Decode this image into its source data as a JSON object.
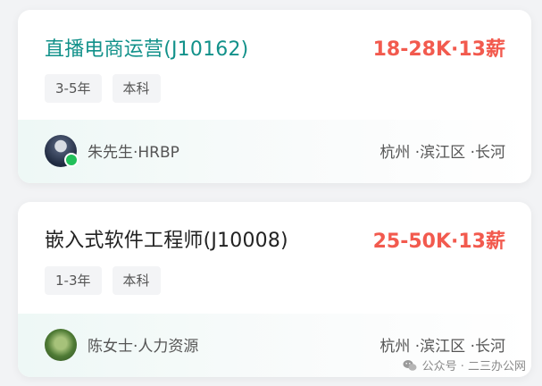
{
  "jobs": [
    {
      "title": "直播电商运营(J10162)",
      "salary": "18-28K·13薪",
      "tags": [
        "3-5年",
        "本科"
      ],
      "recruiter": "朱先生·HRBP",
      "location": "杭州 ·滨江区 ·长河",
      "online": true
    },
    {
      "title": "嵌入式软件工程师(J10008)",
      "salary": "25-50K·13薪",
      "tags": [
        "1-3年",
        "本科"
      ],
      "recruiter": "陈女士·人力资源",
      "location": "杭州 ·滨江区 ·长河",
      "online": false
    }
  ],
  "watermark": {
    "text": "公众号 · 二三办公网",
    "icon": "wechat-icon"
  },
  "colors": {
    "title_accent": "#12918a",
    "salary": "#f25a4e",
    "online": "#22c05a"
  }
}
